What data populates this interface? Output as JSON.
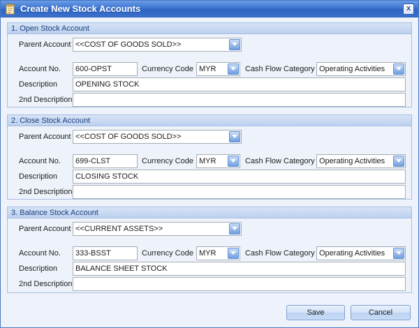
{
  "window": {
    "title": "Create New Stock Accounts",
    "close_glyph": "x"
  },
  "labels": {
    "parent_account": "Parent Account",
    "account_no": "Account No.",
    "currency_code": "Currency Code",
    "cash_flow_category": "Cash Flow Category",
    "description": "Description",
    "second_description": "2nd Description"
  },
  "sections": [
    {
      "header": "1.   Open Stock Account",
      "parent_account": "<<COST OF GOODS SOLD>>",
      "account_no": "600-OPST",
      "currency_code": "MYR",
      "cash_flow_category": "Operating Activities",
      "description": "OPENING STOCK",
      "second_description": ""
    },
    {
      "header": "2.   Close Stock Account",
      "parent_account": "<<COST OF GOODS SOLD>>",
      "account_no": "699-CLST",
      "currency_code": "MYR",
      "cash_flow_category": "Operating Activities",
      "description": "CLOSING STOCK",
      "second_description": ""
    },
    {
      "header": "3.   Balance Stock Account",
      "parent_account": "<<CURRENT ASSETS>>",
      "account_no": "333-BSST",
      "currency_code": "MYR",
      "cash_flow_category": "Operating Activities",
      "description": "BALANCE SHEET STOCK",
      "second_description": ""
    }
  ],
  "buttons": {
    "save": "Save",
    "cancel": "Cancel"
  },
  "icons": {
    "title": "document-form-icon",
    "close": "close-icon",
    "dropdown": "chevron-down-icon"
  },
  "colors": {
    "titlebar": "#3f76d3",
    "section_header": "#bcd0ee",
    "window_bg": "#eef3fb"
  }
}
